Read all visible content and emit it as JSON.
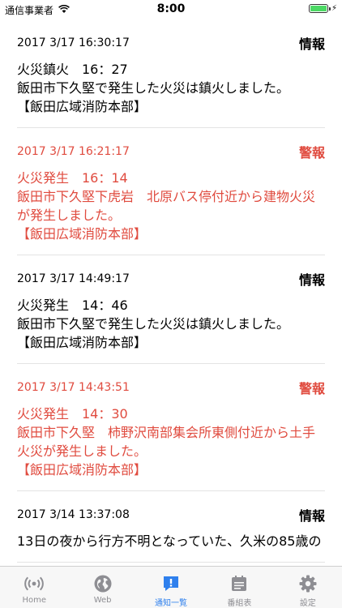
{
  "status_bar": {
    "carrier": "通信事業者",
    "time": "8:00"
  },
  "notifications": [
    {
      "datetime": "2017 3/17 16:30:17",
      "badge": "情報",
      "type": "info",
      "lines": [
        "火災鎮火　16：27",
        "飯田市下久堅で発生した火災は鎮火しました。",
        "【飯田広域消防本部】"
      ]
    },
    {
      "datetime": "2017 3/17 16:21:17",
      "badge": "警報",
      "type": "alert",
      "lines": [
        "火災発生　16：14",
        "飯田市下久堅下虎岩　北原バス停付近から建物火災",
        "が発生しました。",
        "【飯田広域消防本部】"
      ]
    },
    {
      "datetime": "2017 3/17 14:49:17",
      "badge": "情報",
      "type": "info",
      "lines": [
        "火災発生　14：46",
        "飯田市下久堅で発生した火災は鎮火しました。",
        "【飯田広域消防本部】"
      ]
    },
    {
      "datetime": "2017 3/17 14:43:51",
      "badge": "警報",
      "type": "alert",
      "lines": [
        "火災発生　14：30",
        "飯田市下久堅　柿野沢南部集会所東側付近から土手",
        "火災が発生しました。",
        "【飯田広域消防本部】"
      ]
    },
    {
      "datetime": "2017 3/14 13:37:08",
      "badge": "情報",
      "type": "info",
      "lines": [
        "13日の夜から行方不明となっていた、久米の85歳の"
      ]
    }
  ],
  "tabs": [
    {
      "label": "Home",
      "icon": "broadcast-icon",
      "active": false
    },
    {
      "label": "Web",
      "icon": "globe-icon",
      "active": false
    },
    {
      "label": "通知一覧",
      "icon": "notification-icon",
      "active": true
    },
    {
      "label": "番組表",
      "icon": "schedule-icon",
      "active": false
    },
    {
      "label": "設定",
      "icon": "gear-icon",
      "active": false
    }
  ],
  "colors": {
    "alert": "#e04b3f",
    "active_tab": "#2f80ed",
    "inactive_tab": "#8e8e93"
  }
}
